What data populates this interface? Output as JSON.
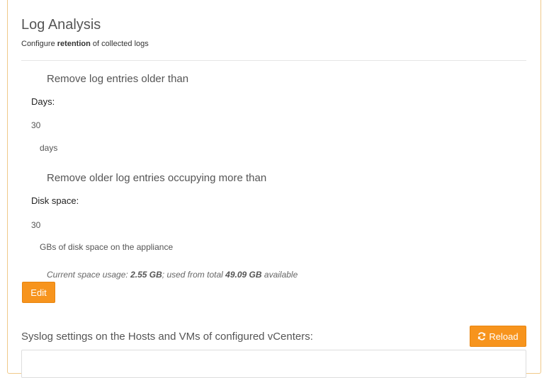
{
  "header": {
    "title": "Log Analysis",
    "subtitle_prefix": "Configure",
    "subtitle_bold": "retention",
    "subtitle_suffix": "of collected logs"
  },
  "age_section": {
    "heading": "Remove log entries older than",
    "label": "Days:",
    "value": "30",
    "unit": "days"
  },
  "disk_section": {
    "heading": "Remove older log entries occupying more than",
    "label": "Disk space:",
    "value": "30",
    "unit": "GBs of disk space on the appliance"
  },
  "usage": {
    "prefix": "Current space usage:",
    "used": "2.55 GB",
    "middle": "; used from total",
    "total": "49.09 GB",
    "suffix": "available"
  },
  "buttons": {
    "edit_label": "Edit",
    "reload_label": "Reload"
  },
  "syslog": {
    "heading": "Syslog settings on the Hosts and VMs of configured vCenters:"
  },
  "colors": {
    "accent": "#f7941d",
    "panel_border": "#f0c98a"
  },
  "icons": {
    "reload": "refresh-icon"
  }
}
